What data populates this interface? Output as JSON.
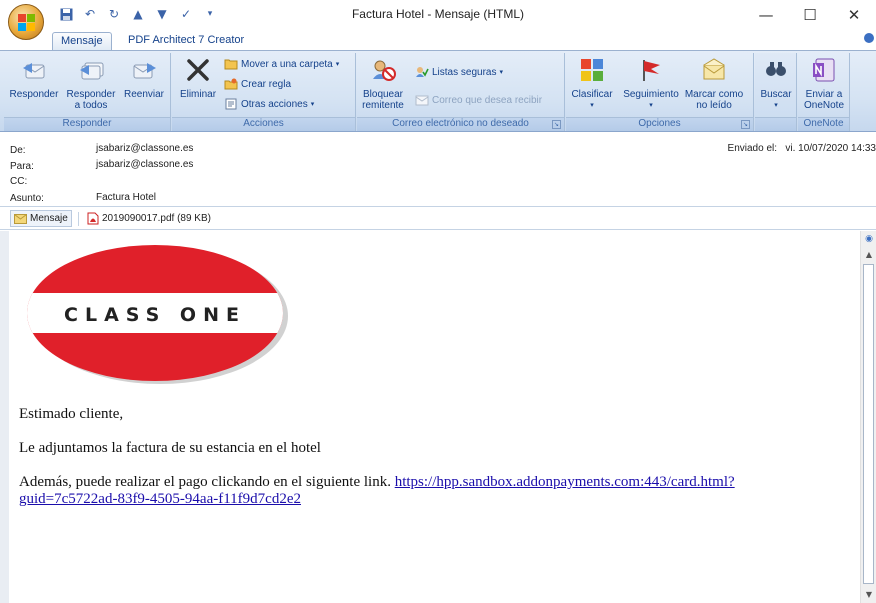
{
  "window": {
    "title": "Factura Hotel - Mensaje (HTML)",
    "minimize": "—",
    "maximize": "☐",
    "close": "✕"
  },
  "tabs": [
    {
      "label": "Mensaje"
    },
    {
      "label": "PDF Architect 7 Creator"
    }
  ],
  "ribbon": {
    "groups": {
      "responder": "Responder",
      "acciones": "Acciones",
      "correo": "Correo electrónico no deseado",
      "opciones": "Opciones",
      "onenote": "OneNote"
    },
    "buttons": {
      "responder": "Responder",
      "responder_todos_1": "Responder",
      "responder_todos_2": "a todos",
      "reenviar": "Reenviar",
      "eliminar": "Eliminar",
      "mover": "Mover a una carpeta",
      "crear_regla": "Crear regla",
      "otras_acciones": "Otras acciones",
      "bloquear_1": "Bloquear",
      "bloquear_2": "remitente",
      "listas_seguras": "Listas seguras",
      "correo_deseado": "Correo que desea recibir",
      "clasificar": "Clasificar",
      "seguimiento": "Seguimiento",
      "marcar_1": "Marcar como",
      "marcar_2": "no leído",
      "buscar": "Buscar",
      "enviar_1": "Enviar a",
      "enviar_2": "OneNote"
    }
  },
  "header": {
    "from_label": "De:",
    "from_value": "jsabariz@classone.es",
    "to_label": "Para:",
    "to_value": "jsabariz@classone.es",
    "cc_label": "CC:",
    "subject_label": "Asunto:",
    "subject_value": "Factura Hotel",
    "sent_label": "Enviado el:",
    "sent_value": "vi. 10/07/2020 14:33"
  },
  "attachments": {
    "message": "Mensaje",
    "file": "2019090017.pdf (89 KB)"
  },
  "body": {
    "logo_text": "CLASS ONE",
    "greeting": "Estimado cliente,",
    "line1": "Le adjuntamos la factura de su estancia en el hotel",
    "line2": "Además, puede realizar el pago clickando en el siguiente link.",
    "link_part1": "https://hpp.sandbox.addonpayments.com:443/card.html?",
    "link_part2": "guid=7c5722ad-83f9-4505-94aa-f11f9d7cd2e2"
  },
  "colors": {
    "ribbon": "#d5e3f3",
    "accent": "#15428b",
    "logo_red": "#e0202a",
    "link": "#1a0dab"
  }
}
